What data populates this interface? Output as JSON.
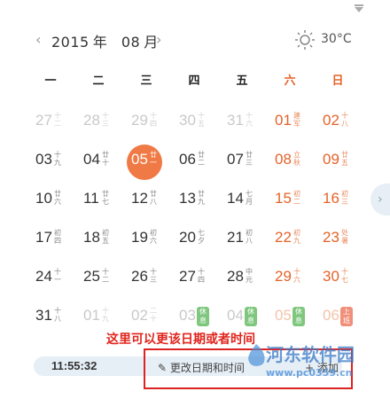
{
  "header": {
    "prev_icon": "‹",
    "next_icon": "›",
    "year": "2015",
    "year_label": "年",
    "month": "08",
    "month_label": "月",
    "weather_icon": "sun-icon",
    "temperature": "30°C"
  },
  "weekdays": [
    "一",
    "二",
    "三",
    "四",
    "五",
    "六",
    "日"
  ],
  "weeks": [
    [
      {
        "d": "27",
        "l": "十二",
        "o": true
      },
      {
        "d": "28",
        "l": "十三",
        "o": true
      },
      {
        "d": "29",
        "l": "十四",
        "o": true
      },
      {
        "d": "30",
        "l": "十五",
        "o": true
      },
      {
        "d": "31",
        "l": "十六",
        "o": true
      },
      {
        "d": "01",
        "l": "建军"
      },
      {
        "d": "02",
        "l": "十八"
      }
    ],
    [
      {
        "d": "03",
        "l": "十九"
      },
      {
        "d": "04",
        "l": "廿十"
      },
      {
        "d": "05",
        "l": "廿一",
        "t": true
      },
      {
        "d": "06",
        "l": "廿二"
      },
      {
        "d": "07",
        "l": "廿三"
      },
      {
        "d": "08",
        "l": "立秋"
      },
      {
        "d": "09",
        "l": "廿五"
      }
    ],
    [
      {
        "d": "10",
        "l": "廿六"
      },
      {
        "d": "11",
        "l": "廿七"
      },
      {
        "d": "12",
        "l": "廿八"
      },
      {
        "d": "13",
        "l": "廿九"
      },
      {
        "d": "14",
        "l": "七月"
      },
      {
        "d": "15",
        "l": "初二"
      },
      {
        "d": "16",
        "l": "初三"
      }
    ],
    [
      {
        "d": "17",
        "l": "初四"
      },
      {
        "d": "18",
        "l": "初五"
      },
      {
        "d": "19",
        "l": "初六"
      },
      {
        "d": "20",
        "l": "七夕"
      },
      {
        "d": "21",
        "l": "初八"
      },
      {
        "d": "22",
        "l": "初九"
      },
      {
        "d": "23",
        "l": "处暑"
      }
    ],
    [
      {
        "d": "24",
        "l": "十一"
      },
      {
        "d": "25",
        "l": "十二"
      },
      {
        "d": "26",
        "l": "十三"
      },
      {
        "d": "27",
        "l": "十四"
      },
      {
        "d": "28",
        "l": "中元"
      },
      {
        "d": "29",
        "l": "十六"
      },
      {
        "d": "30",
        "l": "十七"
      }
    ],
    [
      {
        "d": "31",
        "l": "十八"
      },
      {
        "d": "01",
        "l": "十九",
        "o": true
      },
      {
        "d": "02",
        "l": "二十",
        "o": true
      },
      {
        "d": "03",
        "l": "",
        "o": true,
        "b": "休息",
        "bc": "green"
      },
      {
        "d": "04",
        "l": "",
        "o": true,
        "b": "休息",
        "bc": "green"
      },
      {
        "d": "05",
        "l": "",
        "o": true,
        "b": "休息",
        "bc": "green"
      },
      {
        "d": "06",
        "l": "",
        "o": true,
        "b": "上班",
        "bc": "red"
      }
    ]
  ],
  "footer": {
    "time": "11:55:32",
    "edit_label": "✎ 更改日期和时间",
    "add_label": "+ 添加"
  },
  "annotation": {
    "text": "这里可以更该日期或者时间"
  },
  "watermark": {
    "name": "河东软件园",
    "url": "www.pc0359.cn"
  },
  "colors": {
    "accent": "#f07a45",
    "weekend": "#e5632a",
    "annotation": "#e0241c"
  }
}
